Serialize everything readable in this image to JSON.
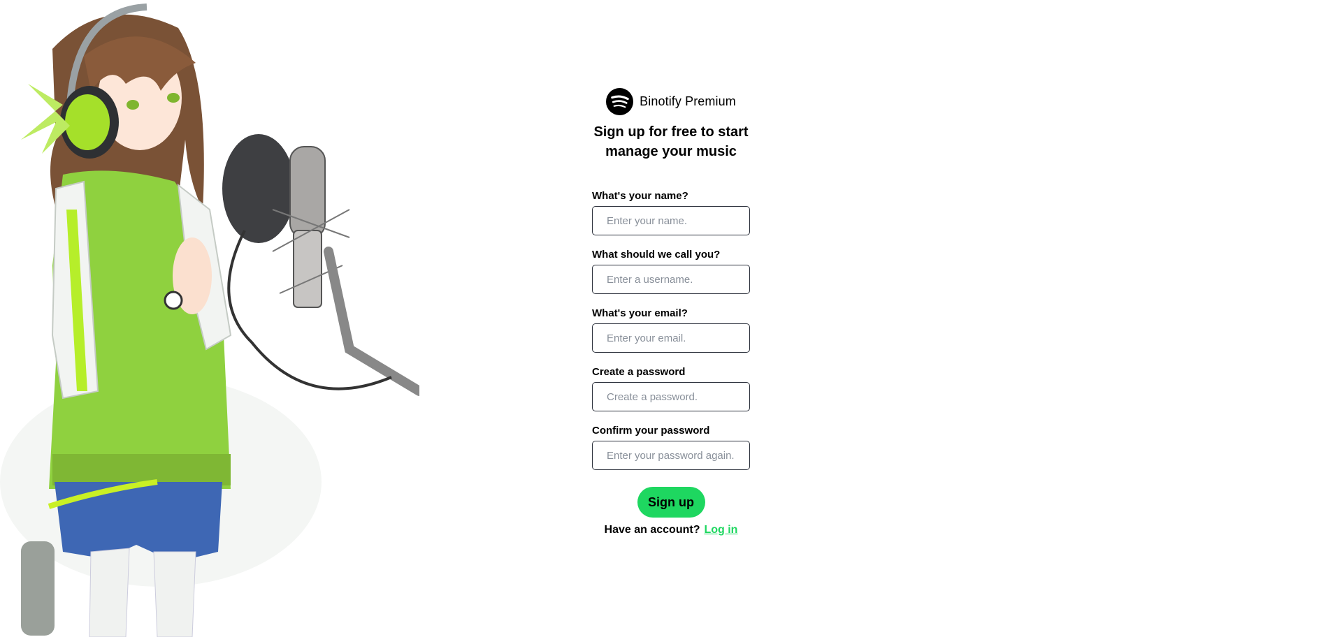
{
  "brand": {
    "name": "Binotify Premium",
    "logo_icon": "spotify-logo-icon"
  },
  "headline": "Sign up for free to start manage your music",
  "form": {
    "fields": [
      {
        "label": "What's your name?",
        "placeholder": "Enter your name.",
        "value": ""
      },
      {
        "label": "What should we call you?",
        "placeholder": "Enter a username.",
        "value": ""
      },
      {
        "label": "What's your email?",
        "placeholder": "Enter your email.",
        "value": ""
      },
      {
        "label": "Create a password",
        "placeholder": "Create a password.",
        "value": ""
      },
      {
        "label": "Confirm your password",
        "placeholder": "Enter your password again.",
        "value": ""
      }
    ],
    "submit_label": "Sign up"
  },
  "login": {
    "prompt": "Have an account?",
    "link_label": "Log in"
  },
  "colors": {
    "accent": "#1ed760",
    "input_border": "#2a2f3a",
    "placeholder": "#888f99"
  }
}
